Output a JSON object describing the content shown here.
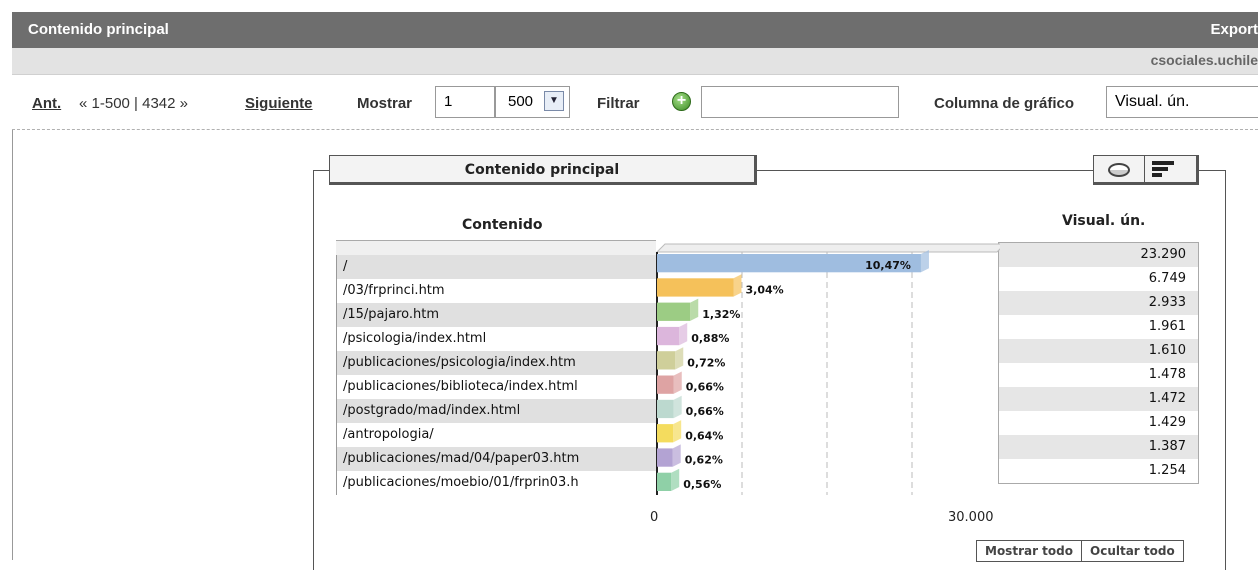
{
  "header": {
    "title": "Contenido principal",
    "export": "Export",
    "domain": "csociales.uchile"
  },
  "toolbar": {
    "prev": "Ant.",
    "range": "« 1-500 | 4342 »",
    "next": "Siguiente",
    "show_label": "Mostrar",
    "start_value": "1",
    "page_size": "500",
    "filter_label": "Filtrar",
    "filter_value": "",
    "chart_col_label": "Columna de gráfico",
    "chart_col_value": "Visual. ún."
  },
  "panel": {
    "title": "Contenido principal",
    "content_header": "Contenido",
    "value_header": "Visual. ún.",
    "show_all": "Mostrar todo",
    "hide_all": "Ocultar todo",
    "view_icons": [
      "pie-chart-icon",
      "bar-chart-icon"
    ]
  },
  "chart_data": {
    "type": "bar",
    "orientation": "horizontal",
    "categories": [
      "/",
      "/03/frprinci.htm",
      "/15/pajaro.htm",
      "/psicologia/index.html",
      "/publicaciones/psicologia/index.htm",
      "/publicaciones/biblioteca/index.html",
      "/postgrado/mad/index.html",
      "/antropologia/",
      "/publicaciones/mad/04/paper03.htm",
      "/publicaciones/moebio/01/frprin03.h"
    ],
    "values": [
      23290,
      6749,
      2933,
      1961,
      1610,
      1478,
      1472,
      1429,
      1387,
      1254
    ],
    "value_labels": [
      "23.290",
      "6.749",
      "2.933",
      "1.961",
      "1.610",
      "1.478",
      "1.472",
      "1.429",
      "1.387",
      "1.254"
    ],
    "percent_labels": [
      "10,47%",
      "3,04%",
      "1,32%",
      "0,88%",
      "0,72%",
      "0,66%",
      "0,66%",
      "0,64%",
      "0,62%",
      "0,56%"
    ],
    "xlim": [
      0,
      30000
    ],
    "x_ticks": [
      "0",
      "30.000"
    ],
    "colors": [
      "#9fbde0",
      "#f5c15a",
      "#9ccc84",
      "#dcb6dc",
      "#cfcf9a",
      "#dea3a3",
      "#bcd9cf",
      "#f4dc5e",
      "#b3a3d3",
      "#8fd0a7"
    ],
    "grid": true
  }
}
